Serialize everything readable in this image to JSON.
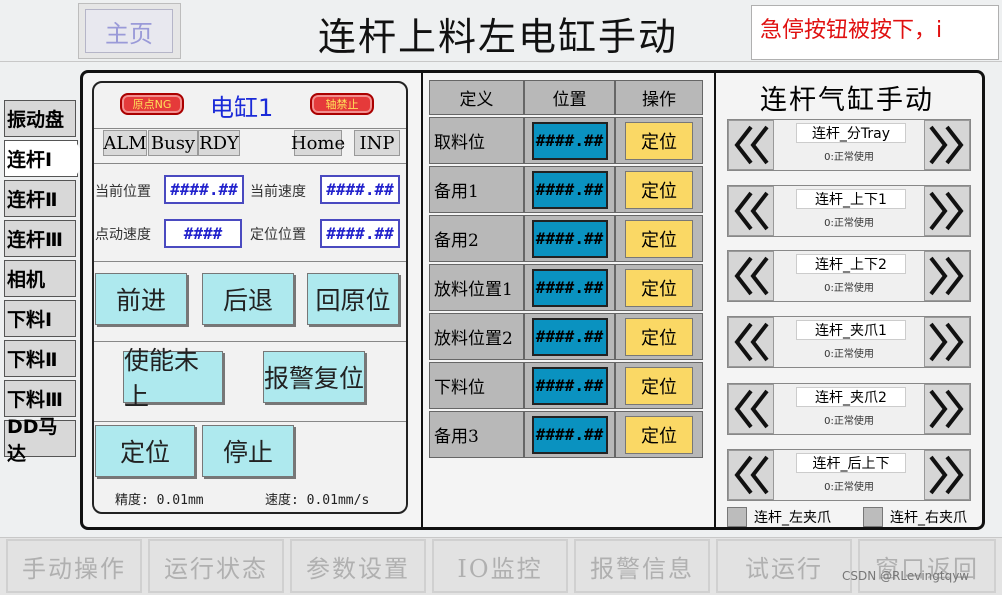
{
  "header": {
    "home_label": "主页",
    "title": "连杆上料左电缸手动",
    "alarm_text": "急停按钮被按下，i"
  },
  "nav": {
    "items": [
      {
        "label": "振动盘"
      },
      {
        "label": "连杆Ⅰ"
      },
      {
        "label": "连杆Ⅱ"
      },
      {
        "label": "连杆Ⅲ"
      },
      {
        "label": "相机"
      },
      {
        "label": "下料Ⅰ"
      },
      {
        "label": "下料Ⅱ"
      },
      {
        "label": "下料Ⅲ"
      },
      {
        "label": "DD马达"
      }
    ],
    "active_index": 1
  },
  "servo": {
    "origin_ng": "原点NG",
    "name": "电缸1",
    "axis_disabled": "轴禁止",
    "status": [
      "ALM",
      "Busy",
      "RDY",
      "Home",
      "INP"
    ],
    "current_pos_label": "当前位置",
    "current_pos_value": "####.##",
    "current_speed_label": "当前速度",
    "current_speed_value": "####.##",
    "jog_speed_label": "点动速度",
    "jog_speed_value": "####",
    "target_pos_label": "定位位置",
    "target_pos_value": "####.##",
    "forward": "前进",
    "backward": "后退",
    "home_return": "回原位",
    "enable": "使能未上",
    "alarm_reset": "报警复位",
    "position": "定位",
    "stop": "停止",
    "precision": "精度: 0.01mm",
    "speed_res": "速度: 0.01mm/s"
  },
  "table": {
    "headers": [
      "定义",
      "位置",
      "操作"
    ],
    "rows": [
      {
        "name": "取料位",
        "value": "####.##",
        "action": "定位"
      },
      {
        "name": "备用1",
        "value": "####.##",
        "action": "定位"
      },
      {
        "name": "备用2",
        "value": "####.##",
        "action": "定位"
      },
      {
        "name": "放料位置1",
        "value": "####.##",
        "action": "定位"
      },
      {
        "name": "放料位置2",
        "value": "####.##",
        "action": "定位"
      },
      {
        "name": "下料位",
        "value": "####.##",
        "action": "定位"
      },
      {
        "name": "备用3",
        "value": "####.##",
        "action": "定位"
      }
    ]
  },
  "cylinders": {
    "title": "连杆气缸手动",
    "items": [
      {
        "name": "连杆_分Tray",
        "status": "0:正常使用"
      },
      {
        "name": "连杆_上下1",
        "status": "0:正常使用"
      },
      {
        "name": "连杆_上下2",
        "status": "0:正常使用"
      },
      {
        "name": "连杆_夹爪1",
        "status": "0:正常使用"
      },
      {
        "name": "连杆_夹爪2",
        "status": "0:正常使用"
      },
      {
        "name": "连杆_后上下",
        "status": "0:正常使用"
      }
    ],
    "checks": [
      {
        "label": "连杆_左夹爪"
      },
      {
        "label": "连杆_右夹爪"
      }
    ]
  },
  "bottom": {
    "items": [
      {
        "label": "手动操作"
      },
      {
        "label": "运行状态"
      },
      {
        "label": "参数设置"
      },
      {
        "label": "IO监控"
      },
      {
        "label": "报警信息"
      },
      {
        "label": "试运行"
      },
      {
        "label": "窗口返回"
      }
    ],
    "watermark": "CSDN @RLevingtqyw"
  },
  "colors": {
    "accent_cyan": "#aee9ee",
    "pos_blue": "#0a92c0",
    "loc_yellow": "#fad865",
    "alarm_red": "#e01010"
  }
}
